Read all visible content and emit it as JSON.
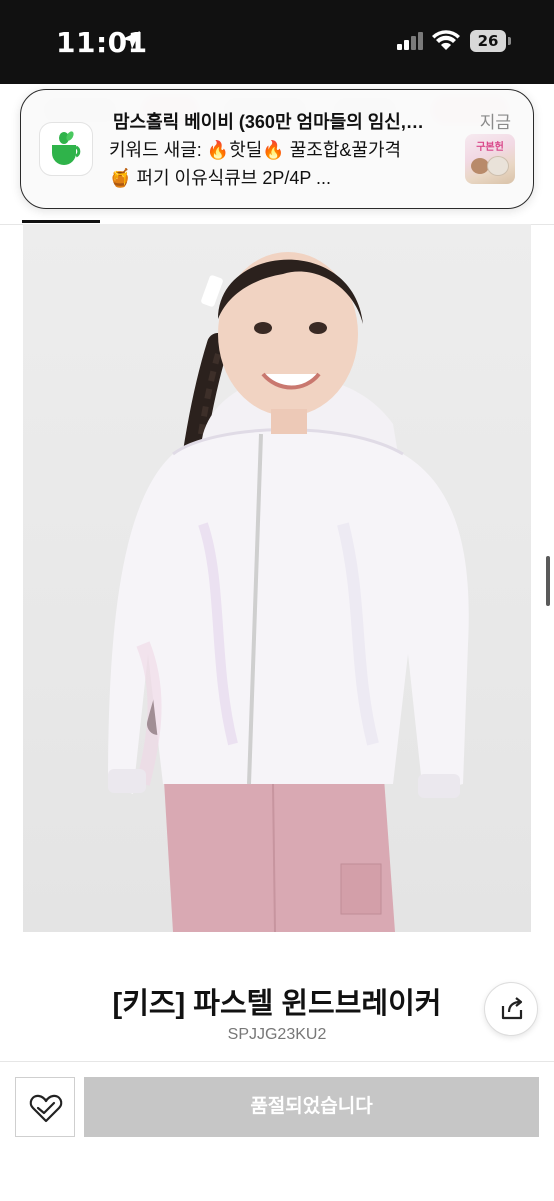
{
  "status_bar": {
    "time": "11:01",
    "battery": "26"
  },
  "notification": {
    "app_icon": "teacup-app-icon",
    "title": "맘스홀릭 베이비 (360만 엄마들의 임신,…",
    "line1": "키워드 새글: 🔥핫딜🔥 꿀조합&꿀가격",
    "line2": "🍯 퍼기 이유식큐브 2P/4P ...",
    "time": "지금",
    "thumbnail_label": "구본헌"
  },
  "product": {
    "title": "[키즈] 파스텔 윈드브레이커",
    "code": "SPJJG23KU2",
    "image": "girl-in-iridescent-windbreaker-photo"
  },
  "actions": {
    "share_icon": "share-icon",
    "wish_icon": "heart-check-icon",
    "soldout_label": "품절되었습니다"
  }
}
